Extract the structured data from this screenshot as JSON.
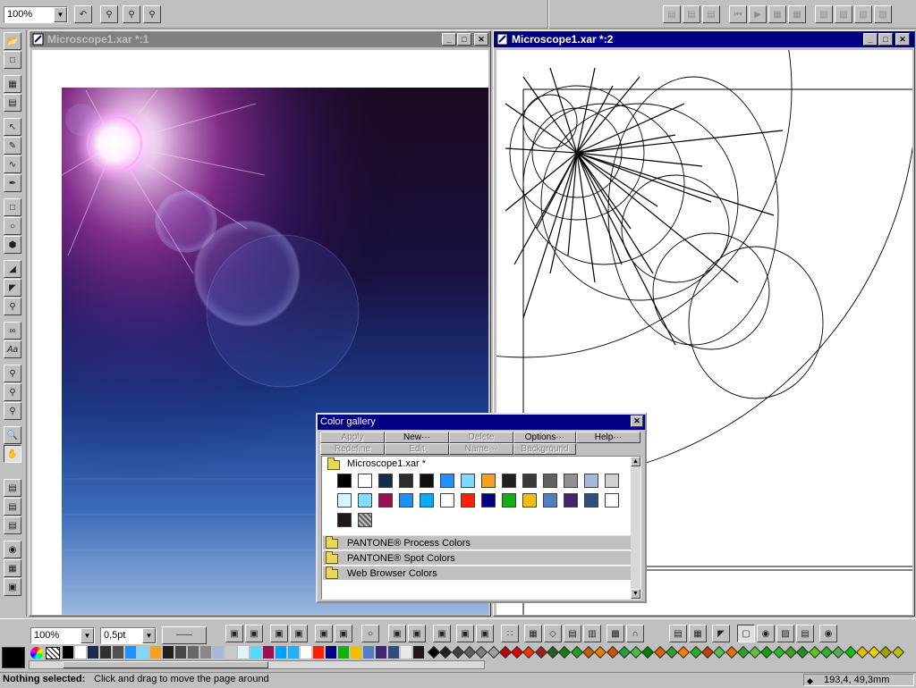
{
  "top_toolbar": {
    "zoom_value": "100%"
  },
  "left_window": {
    "title": "Microscope1.xar *:1"
  },
  "right_window": {
    "title": "Microscope1.xar *:2"
  },
  "color_gallery": {
    "title": "Color gallery",
    "buttons_row1": [
      "Apply",
      "New···",
      "Delete",
      "Options···",
      "Help···"
    ],
    "buttons_row2": [
      "Redefine",
      "Edit",
      "Name···",
      "Background"
    ],
    "doc_folder": "Microscope1.xar *",
    "swatches": [
      "#000000",
      "#ffffff",
      "#1a2a4a",
      "#2c2c2c",
      "#101010",
      "#1e90ff",
      "#7fd8ff",
      "#f4a020",
      "#202020",
      "#3a3a3a",
      "#606060",
      "#909090",
      "#a8b8d8",
      "#d0d0d0",
      "#d8f4ff",
      "#7fe0ff",
      "#9a1050",
      "#1a90ff",
      "#00aaff",
      "#ffffff",
      "#ff2000",
      "#000080",
      "#10b010",
      "#f0c000",
      "#5080c0",
      "#402870",
      "#2e4e7e",
      "#ffffff",
      "#201818",
      "#a0a0a0"
    ],
    "groups": [
      "PANTONE® Process Colors",
      "PANTONE® Spot Colors",
      "Web Browser Colors"
    ]
  },
  "bottom_toolbar": {
    "zoom_value": "100%",
    "line_width": "0,5pt"
  },
  "status_bar": {
    "label": "Nothing selected:",
    "message": "Click and drag to move the page around",
    "coords": "193,4, 49,3mm"
  },
  "palette_colors": [
    "#000000",
    "#ffffff",
    "#1a2a4a",
    "#303030",
    "#505050",
    "#1e90ff",
    "#7fd8ff",
    "#f4a020",
    "#202020",
    "#484848",
    "#686868",
    "#888888",
    "#a8b8d8",
    "#c8c8c8",
    "#e0f4ff",
    "#50d8ff",
    "#9a1050",
    "#00a0ff",
    "#20b0ff",
    "#ffffff",
    "#ff2000",
    "#000080",
    "#10b010",
    "#f0c000",
    "#5080c0",
    "#402870",
    "#2e4e7e",
    "#e8e8e8",
    "#201818"
  ],
  "diamond_colors": [
    "#000000",
    "#202020",
    "#404040",
    "#606060",
    "#808080",
    "#a0a0a0",
    "#c00000",
    "#e00000",
    "#ff3000",
    "#a02020",
    "#206020",
    "#108010",
    "#20a020",
    "#c06000",
    "#e08000",
    "#d05000",
    "#20a040",
    "#40c040",
    "#008000",
    "#e06000",
    "#30a030",
    "#f08000",
    "#20b020",
    "#c04000",
    "#50c050",
    "#e07000",
    "#30a030",
    "#60c040",
    "#10a010",
    "#20c020",
    "#40a020",
    "#209020",
    "#60c020",
    "#30b030",
    "#50b050",
    "#10c010",
    "#e0c000",
    "#f0d000",
    "#a0a000",
    "#c0c000"
  ]
}
